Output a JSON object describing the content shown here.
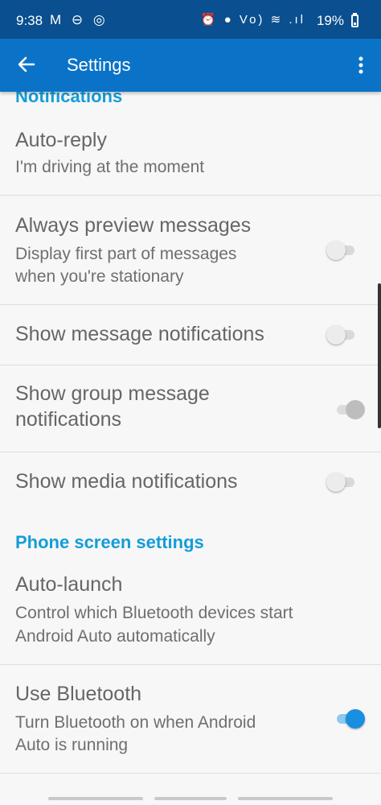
{
  "status_bar": {
    "time": "9:38",
    "left_icons": "M ⊖ ◎",
    "right_icons": "⏰ ● Vo) ≋ .ıl",
    "battery": "19%"
  },
  "app_bar": {
    "title": "Settings"
  },
  "sections": {
    "notifications": "Notifications",
    "phone_screen": "Phone screen settings"
  },
  "rows": {
    "auto_reply": {
      "title": "Auto-reply",
      "sub": "I'm driving at the moment"
    },
    "always_preview": {
      "title": "Always preview messages",
      "sub1": "Display first part of messages",
      "sub2": "when you're stationary",
      "toggle": "off"
    },
    "show_message": {
      "title": "Show message notifications",
      "toggle": "off"
    },
    "show_group": {
      "title1": "Show group message",
      "title2": "notifications",
      "toggle": "on-disabled"
    },
    "show_media": {
      "title": "Show media notifications",
      "toggle": "off"
    },
    "auto_launch": {
      "title": "Auto-launch",
      "sub1": "Control which Bluetooth devices start",
      "sub2": "Android Auto automatically"
    },
    "use_bluetooth": {
      "title": "Use Bluetooth",
      "sub1": "Turn Bluetooth on when Android",
      "sub2": "Auto is running",
      "toggle": "on"
    }
  },
  "colors": {
    "status_bar": "#0a4f8f",
    "app_bar": "#0b73c7",
    "section_header": "#139dd8",
    "toggle_on": "#1a8ee0"
  }
}
